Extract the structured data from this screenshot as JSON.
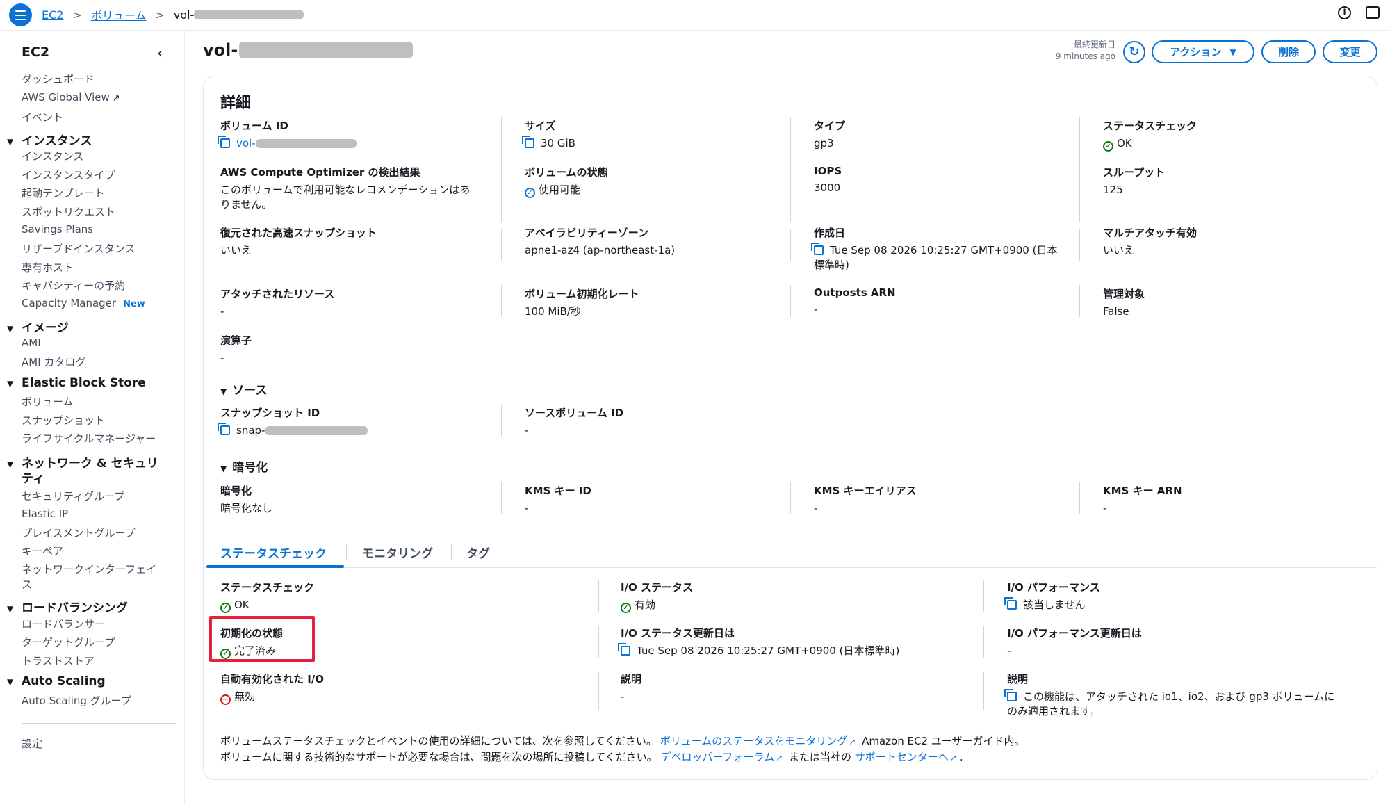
{
  "breadcrumb": {
    "items": [
      "EC2",
      "ボリューム",
      "vol-"
    ]
  },
  "sidebar": {
    "title": "EC2",
    "top_items": [
      "ダッシュボード",
      "AWS Global View",
      "イベント"
    ],
    "sections": [
      {
        "title": "インスタンス",
        "items": [
          "インスタンス",
          "インスタンスタイプ",
          "起動テンプレート",
          "スポットリクエスト",
          "Savings Plans",
          "リザーブドインスタンス",
          "専有ホスト",
          "キャパシティーの予約",
          "Capacity Manager"
        ]
      },
      {
        "title": "イメージ",
        "items": [
          "AMI",
          "AMI カタログ"
        ]
      },
      {
        "title": "Elastic Block Store",
        "items": [
          "ボリューム",
          "スナップショット",
          "ライフサイクルマネージャー"
        ]
      },
      {
        "title_line1": "ネットワーク & セキュリ",
        "title_line2": "ティ",
        "items": [
          "セキュリティグループ",
          "Elastic IP",
          "プレイスメントグループ",
          "キーペア",
          "ネットワークインターフェイ",
          "ス"
        ]
      },
      {
        "title": "ロードバランシング",
        "items": [
          "ロードバランサー",
          "ターゲットグループ",
          "トラストストア"
        ]
      },
      {
        "title": "Auto Scaling",
        "items": [
          "Auto Scaling グループ"
        ]
      }
    ],
    "new_badge": "New",
    "settings": "設定"
  },
  "header": {
    "title": "vol-",
    "last_updated_label": "最終更新日",
    "last_updated_value": "9 minutes ago",
    "actions_label": "アクション",
    "delete_label": "削除",
    "modify_label": "変更"
  },
  "details": {
    "title": "詳細",
    "volume_id": {
      "label": "ボリューム ID",
      "value": "vol-"
    },
    "size": {
      "label": "サイズ",
      "value": "30 GiB"
    },
    "type": {
      "label": "タイプ",
      "value": "gp3"
    },
    "status_check": {
      "label": "ステータスチェック",
      "value": "OK"
    },
    "optimizer": {
      "label": "AWS Compute Optimizer の検出結果",
      "value_line1": "このボリュームで利用可能なレコメンデーションはあ",
      "value_line2": "りません。"
    },
    "volume_state": {
      "label": "ボリュームの状態",
      "value": "使用可能"
    },
    "iops": {
      "label": "IOPS",
      "value": "3000"
    },
    "throughput": {
      "label": "スループット",
      "value": "125"
    },
    "fast_snapshot": {
      "label": "復元された高速スナップショット",
      "value": "いいえ"
    },
    "az": {
      "label": "アベイラビリティーゾーン",
      "value": "apne1-az4 (ap-northeast-1a)"
    },
    "created": {
      "label": "作成日",
      "value_line1": "Tue Sep 08 2026 10:25:27 GMT+0900 (日本",
      "value_line2": "標準時)"
    },
    "multi_attach": {
      "label": "マルチアタッチ有効",
      "value": "いいえ"
    },
    "attached_resources": {
      "label": "アタッチされたリソース",
      "value": "-"
    },
    "init_rate": {
      "label": "ボリューム初期化レート",
      "value": "100 MiB/秒"
    },
    "outposts_arn": {
      "label": "Outposts ARN",
      "value": "-"
    },
    "managed": {
      "label": "管理対象",
      "value": "False"
    },
    "operator": {
      "label": "演算子",
      "value": "-"
    }
  },
  "source": {
    "title": "ソース",
    "snapshot_id": {
      "label": "スナップショット ID",
      "value": "snap-"
    },
    "source_volume_id": {
      "label": "ソースボリューム ID",
      "value": "-"
    }
  },
  "encryption": {
    "title": "暗号化",
    "encryption": {
      "label": "暗号化",
      "value": "暗号化なし"
    },
    "kms_key_id": {
      "label": "KMS キー ID",
      "value": "-"
    },
    "kms_alias": {
      "label": "KMS キーエイリアス",
      "value": "-"
    },
    "kms_arn": {
      "label": "KMS キー ARN",
      "value": "-"
    }
  },
  "tabs": [
    "ステータスチェック",
    "モニタリング",
    "タグ"
  ],
  "status_tab": {
    "status_check": {
      "label": "ステータスチェック",
      "value": "OK"
    },
    "io_status": {
      "label": "I/O ステータス",
      "value": "有効"
    },
    "io_performance": {
      "label": "I/O パフォーマンス",
      "value": "該当しません"
    },
    "init_state": {
      "label": "初期化の状態",
      "value": "完了済み"
    },
    "io_status_updated": {
      "label": "I/O ステータス更新日は",
      "value": "Tue Sep 08 2026 10:25:27 GMT+0900 (日本標準時)"
    },
    "io_perf_updated": {
      "label": "I/O パフォーマンス更新日は",
      "value": "-"
    },
    "auto_io": {
      "label": "自動有効化された I/O",
      "value": "無効"
    },
    "description": {
      "label": "説明",
      "value": "-"
    },
    "description2": {
      "label": "説明",
      "value_line1": "この機能は、アタッチされた io1、io2、および gp3 ボリュームに",
      "value_line2": "のみ適用されます。"
    }
  },
  "footer": {
    "line1_prefix": "ボリュームステータスチェックとイベントの使用の詳細については、次を参照してください。",
    "line1_link": "ボリュームのステータスをモニタリング",
    "line1_suffix": "Amazon EC2 ユーザーガイド内。",
    "line2_prefix": "ボリュームに関する技術的なサポートが必要な場合は、問題を次の場所に投稿してください。",
    "line2_link1": "デベロッパーフォーラム",
    "line2_mid": "または当社の",
    "line2_link2": "サポートセンターへ",
    "line2_end": "."
  },
  "colors": {
    "accent": "#0972d3",
    "success": "#037f0c",
    "error": "#d91515",
    "highlight": "#e8203d"
  }
}
